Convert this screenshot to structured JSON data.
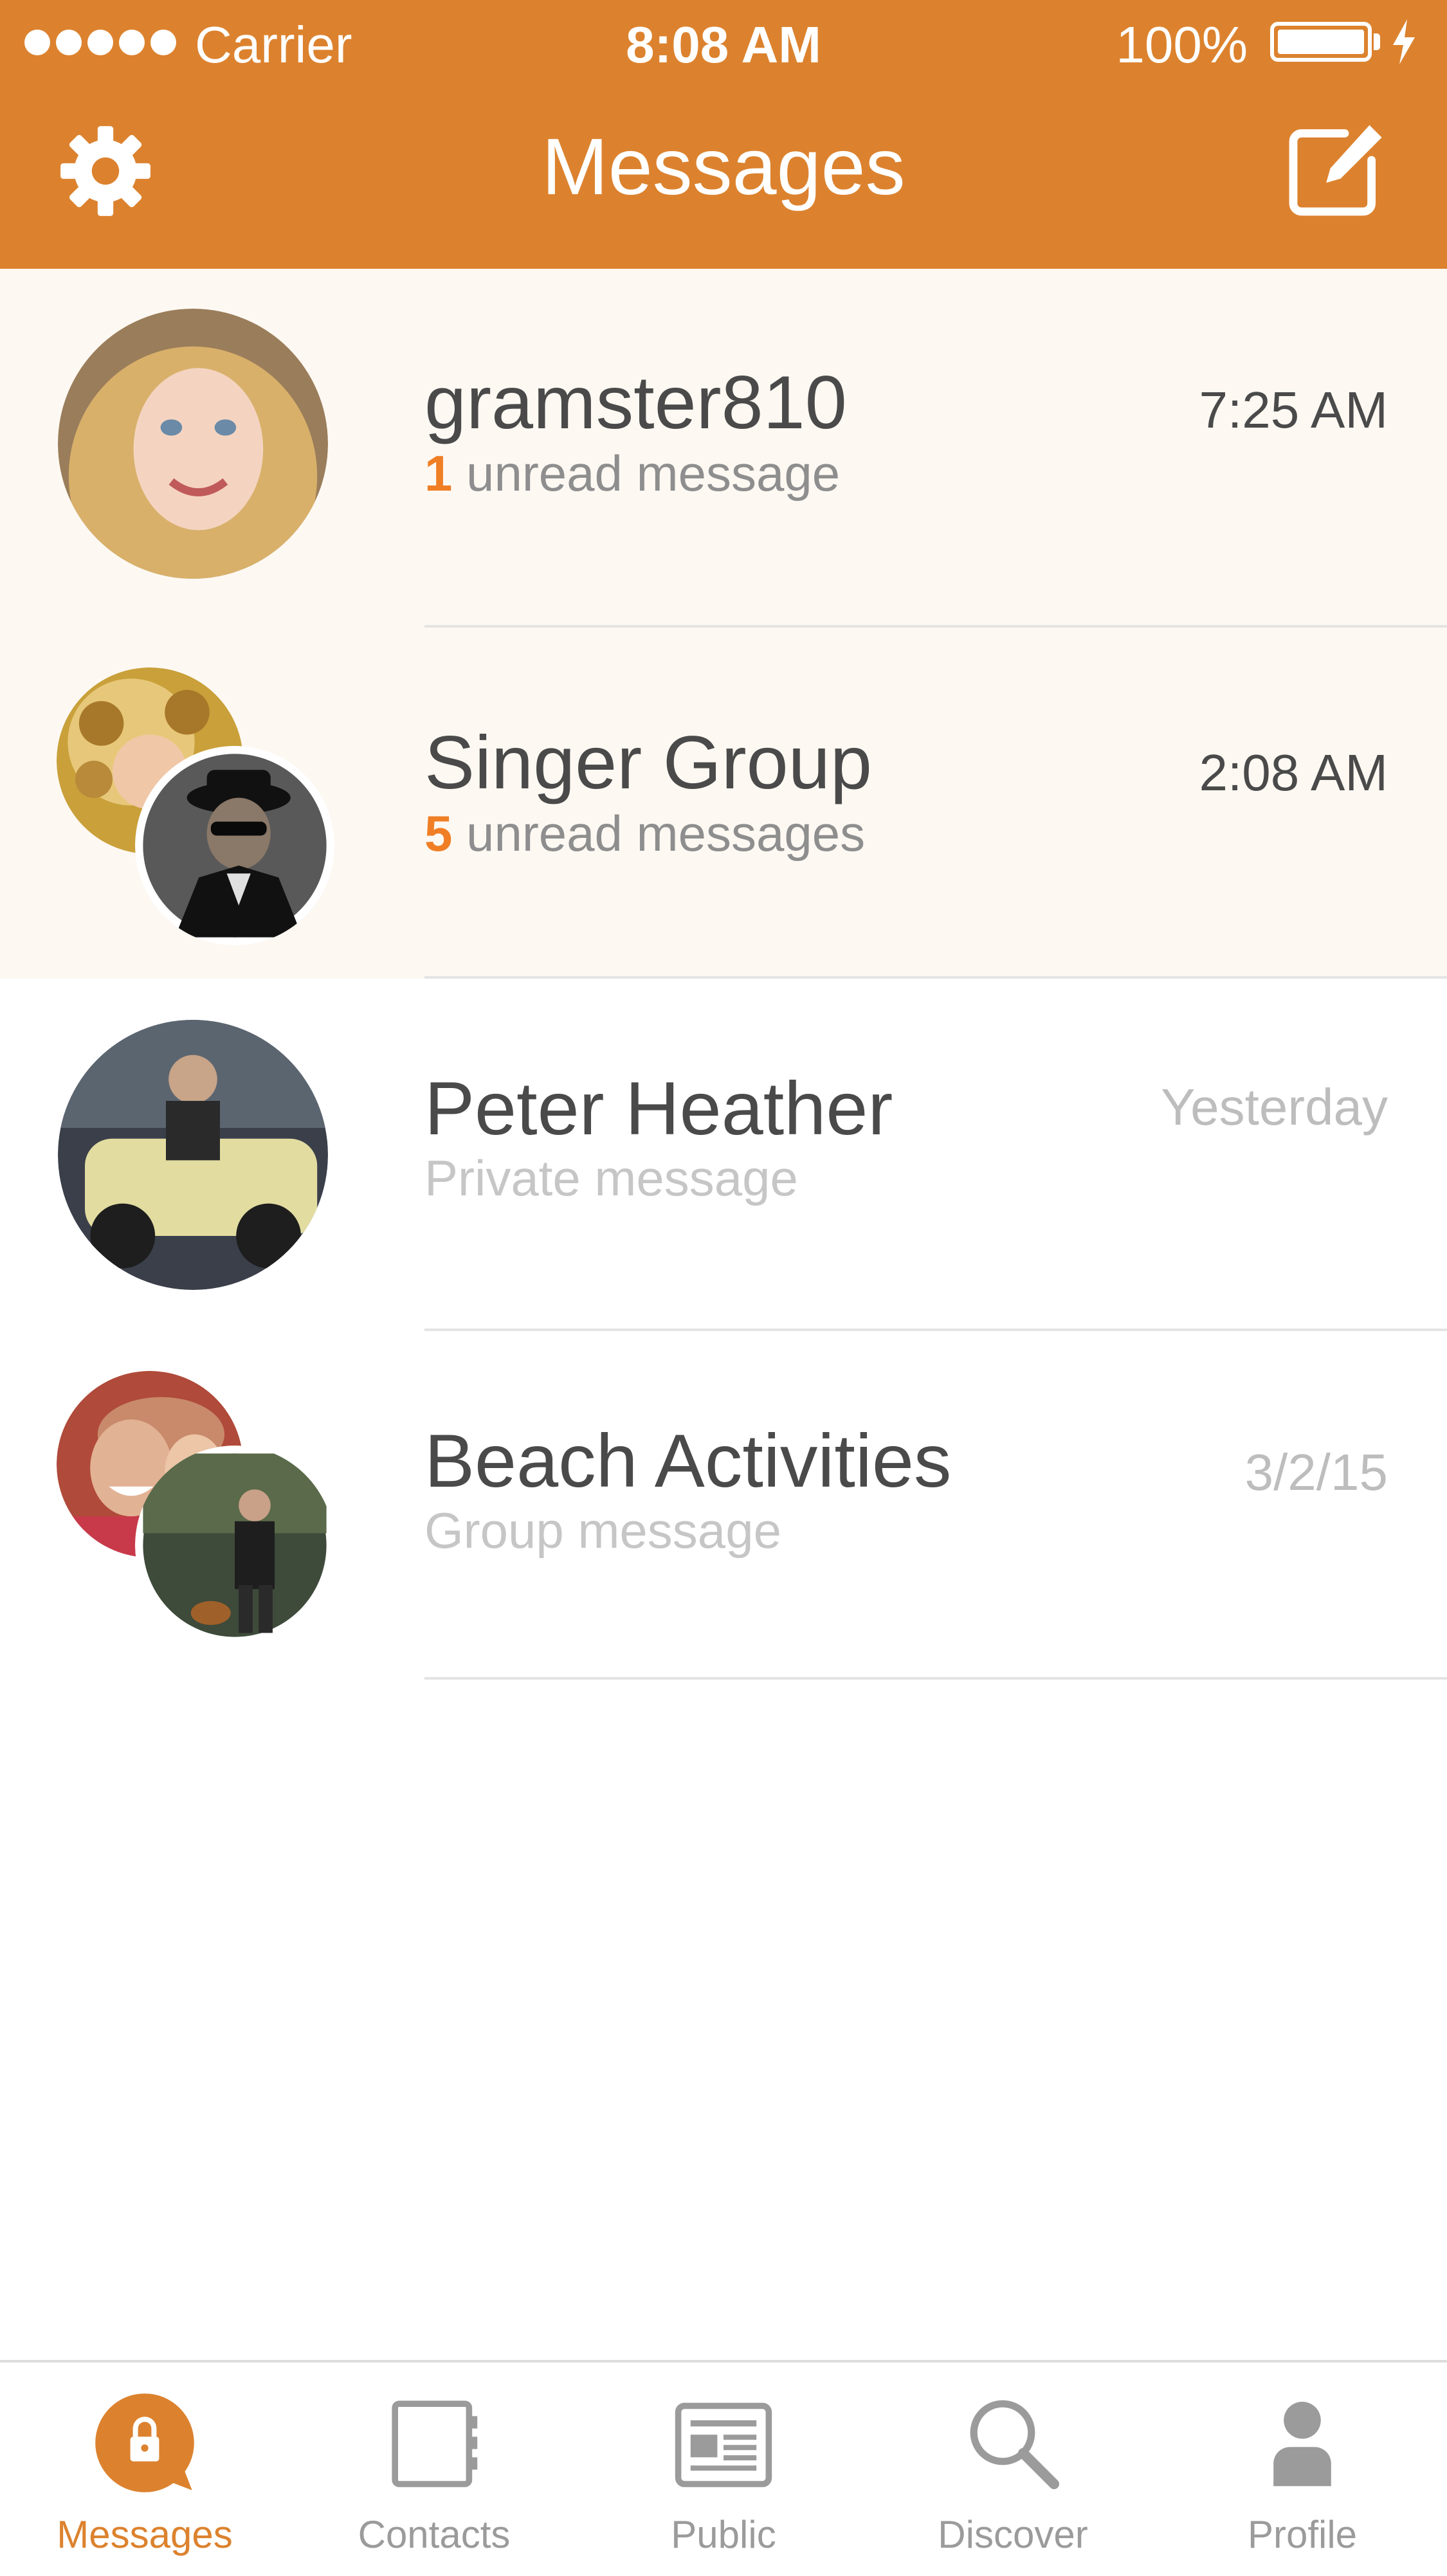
{
  "status_bar": {
    "carrier": "Carrier",
    "time": "8:08 AM",
    "battery": "100%",
    "signal_bars": 5
  },
  "nav": {
    "title": "Messages",
    "left_icon": "gear-icon",
    "right_icon": "compose-icon"
  },
  "colors": {
    "accent": "#dc822e",
    "unread_count": "#f07e25",
    "unread_row_bg": "#fdf8f2"
  },
  "conversations": [
    {
      "name": "gramster810",
      "count": "1",
      "subtitle": " unread message",
      "time": "7:25 AM",
      "unread": true
    },
    {
      "name": "Singer Group",
      "count": "5",
      "subtitle": " unread messages",
      "time": "2:08 AM",
      "unread": true
    },
    {
      "name": "Peter Heather",
      "subtitle": "Private message",
      "time": "Yesterday",
      "unread": false
    },
    {
      "name": "Beach Activities",
      "subtitle": "Group message",
      "time": "3/2/15",
      "unread": false
    }
  ],
  "tabs": [
    {
      "label": "Messages",
      "icon": "lock-bubble-icon",
      "active": true
    },
    {
      "label": "Contacts",
      "icon": "contacts-book-icon",
      "active": false
    },
    {
      "label": "Public",
      "icon": "newspaper-icon",
      "active": false
    },
    {
      "label": "Discover",
      "icon": "search-icon",
      "active": false
    },
    {
      "label": "Profile",
      "icon": "person-icon",
      "active": false
    }
  ]
}
